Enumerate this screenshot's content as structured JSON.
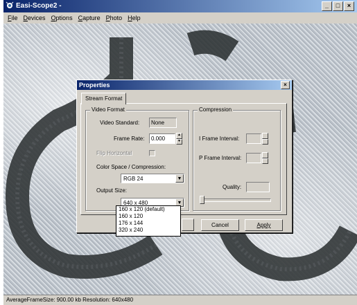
{
  "window": {
    "title": "Easi-Scope2 -",
    "controls": [
      "_",
      "□",
      "×"
    ]
  },
  "menu": [
    {
      "label": "File",
      "hot": "F",
      "rest": "ile"
    },
    {
      "label": "Devices",
      "hot": "D",
      "rest": "evices"
    },
    {
      "label": "Options",
      "hot": "O",
      "rest": "ptions"
    },
    {
      "label": "Capture",
      "hot": "C",
      "rest": "apture"
    },
    {
      "label": "Photo",
      "hot": "P",
      "rest": "hoto"
    },
    {
      "label": "Help",
      "hot": "H",
      "rest": "elp"
    }
  ],
  "status": {
    "text": "AverageFrameSize: 900.00 kb   Resolution: 640x480"
  },
  "dialog": {
    "title": "Properties",
    "close": "×",
    "tab": "Stream Format",
    "video_format": {
      "legend": "Video Format",
      "video_standard_label": "Video Standard:",
      "video_standard_value": "None",
      "frame_rate_label": "Frame Rate:",
      "frame_rate_value": "0.000",
      "flip_horizontal_label": "Flip Horizontal",
      "color_space_label": "Color Space / Compression:",
      "color_space_value": "RGB 24",
      "output_size_label": "Output Size:",
      "output_size_value": "640 x 480",
      "output_size_options": [
        "160 x 120  (default)",
        "160 x 120",
        "176 x 144",
        "320 x 240"
      ]
    },
    "compression": {
      "legend": "Compression",
      "i_frame_label": "I Frame Interval:",
      "p_frame_label": "P Frame Interval:",
      "quality_label": "Quality:"
    },
    "buttons": {
      "cancel": "Cancel",
      "apply": "Apply"
    }
  },
  "icons": {
    "up": "▲",
    "down": "▼",
    "combo_arrow": "▼"
  }
}
